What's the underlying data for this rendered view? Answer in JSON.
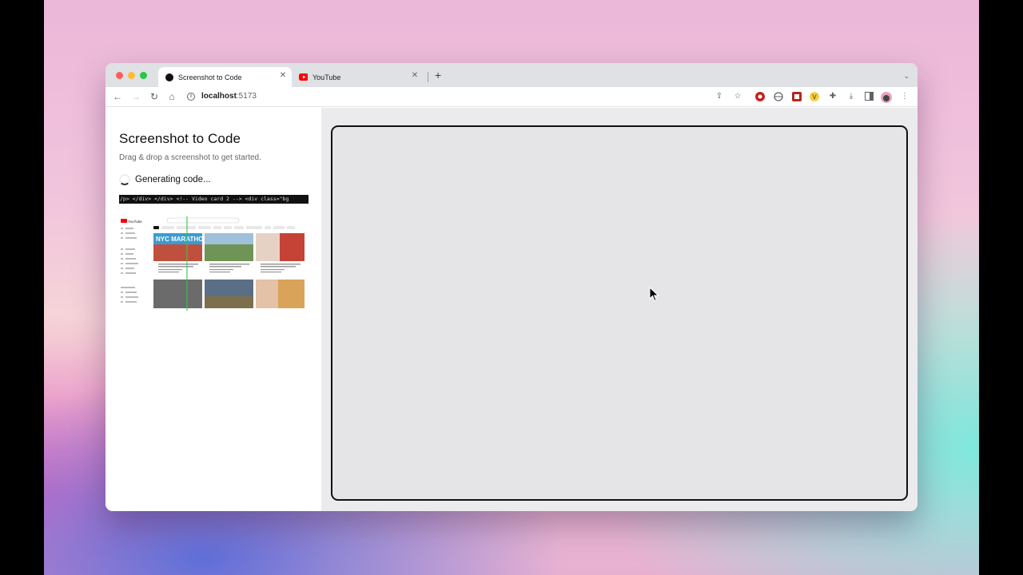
{
  "browser": {
    "tabs": [
      {
        "title": "Screenshot to Code",
        "active": true,
        "favicon": "circle-favicon"
      },
      {
        "title": "YouTube",
        "active": false,
        "favicon": "youtube-favicon"
      }
    ],
    "new_tab_label": "+",
    "address": {
      "host": "localhost",
      "port": ":5173"
    },
    "colors": {
      "close": "#ff5f57",
      "minimize": "#febc2e",
      "maximize": "#28c840",
      "youtube_red": "#ff0000"
    }
  },
  "app": {
    "title": "Screenshot to Code",
    "subtitle": "Drag & drop a screenshot to get started.",
    "status": "Generating code...",
    "code_stream": "/p> </div> </div> <!-- Video card 2 --> <div class=\"bg"
  },
  "preview": {
    "logo_text": "YouTube",
    "thumbnail_banner": "NYC MARATHON"
  }
}
